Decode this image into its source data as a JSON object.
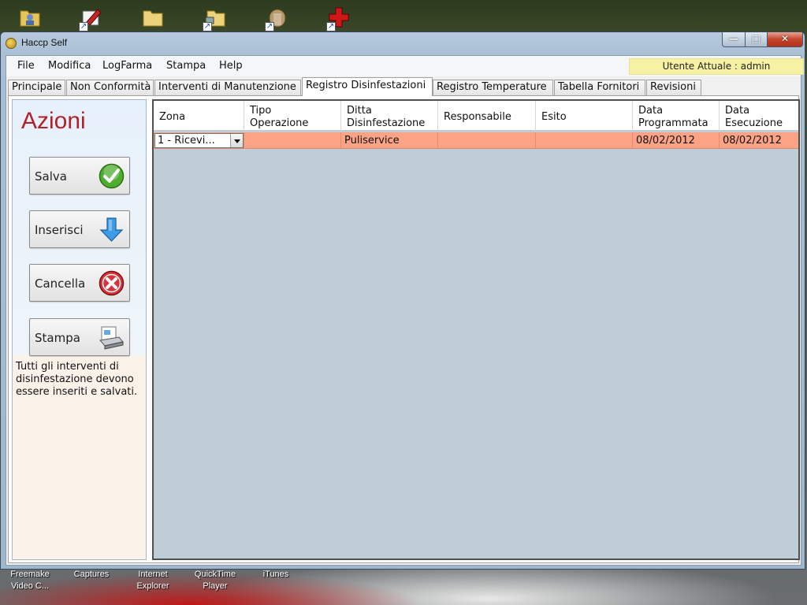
{
  "window": {
    "title": "Haccp Self"
  },
  "menu": {
    "items": [
      "File",
      "Modifica",
      "LogFarma",
      "Stampa",
      "Help"
    ]
  },
  "user": {
    "label": "Utente Attuale : admin"
  },
  "tabs": {
    "items": [
      "Principale",
      "Non Conformità",
      "Interventi di Manutenzione",
      "Registro Disinfestazioni",
      "Registro Temperature",
      "Tabella Fornitori",
      "Revisioni"
    ],
    "active": "Registro Disinfestazioni"
  },
  "actions": {
    "title": "Azioni",
    "buttons": [
      {
        "label": "Salva",
        "icon": "checkmark-icon"
      },
      {
        "label": "Inserisci",
        "icon": "arrow-down-icon"
      },
      {
        "label": "Cancella",
        "icon": "delete-x-icon"
      },
      {
        "label": "Stampa",
        "icon": "printer-icon"
      }
    ],
    "note": "Tutti gli interventi di disinfestazione devono essere inseriti e salvati."
  },
  "grid": {
    "columns": [
      [
        "Zona"
      ],
      [
        "Tipo",
        "Operazione"
      ],
      [
        "Ditta",
        "Disinfestazione"
      ],
      [
        "Responsabile"
      ],
      [
        "Esito"
      ],
      [
        "Data",
        "Programmata"
      ],
      [
        "Data",
        "Esecuzione"
      ]
    ],
    "rows": [
      {
        "zona": "1 - Ricevi...",
        "tipo_operazione": "",
        "ditta": "Puliservice",
        "responsabile": "",
        "esito": "",
        "data_programmata": "08/02/2012",
        "data_esecuzione": "08/02/2012"
      }
    ],
    "row_color": "#fba384"
  },
  "desktop": {
    "icons": [
      "user-folder-icon",
      "edit-app-icon",
      "folder-icon",
      "folder-shortcut-icon",
      "archive-shortcut-icon",
      "red-cross-shortcut-icon"
    ],
    "labels": [
      [
        "Freemake",
        "Video C..."
      ],
      [
        "Captures"
      ],
      [
        "Internet",
        "Explorer"
      ],
      [
        "QuickTime",
        "Player"
      ],
      [
        "iTunes"
      ]
    ]
  }
}
